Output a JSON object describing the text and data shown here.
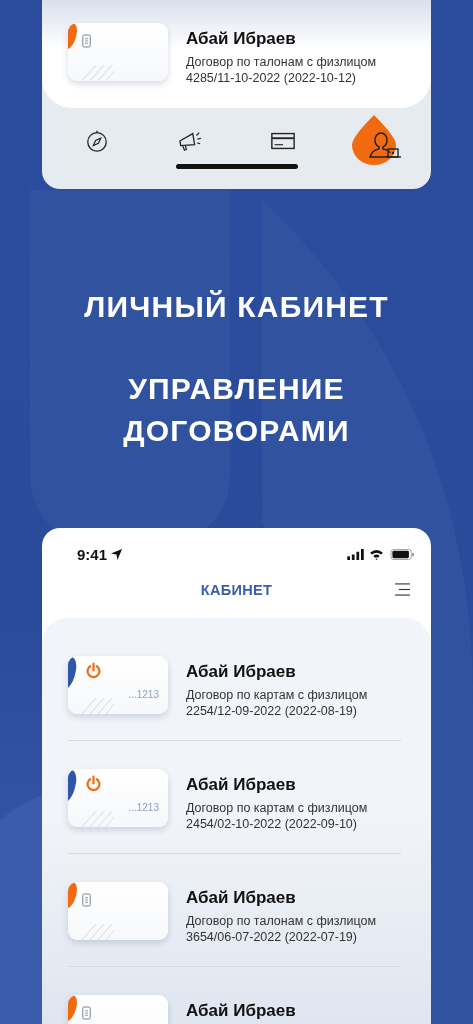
{
  "top_screen": {
    "contracts": [
      {
        "kind": "tickets",
        "name": "Абай Ибраев",
        "type": "Договор по талонам с физлицом",
        "number": "4285/11-10-2022 (2022-10-12)"
      }
    ],
    "tabs": [
      {
        "kind": "compass",
        "selected": false
      },
      {
        "kind": "megaphone",
        "selected": false
      },
      {
        "kind": "card",
        "selected": false
      },
      {
        "kind": "profile",
        "selected": true
      }
    ]
  },
  "headline": [
    "ЛИЧНЫЙ КАБИНЕТ",
    "УПРАВЛЕНИЕ ДОГОВОРАМИ"
  ],
  "bottom_screen": {
    "status_bar": {
      "time": "9:41"
    },
    "title": "КАБИНЕТ",
    "contracts": [
      {
        "kind": "cards",
        "card_suffix": "...1213",
        "name": "Абай Ибраев",
        "type": "Договор по картам с физлицом",
        "number": "2254/12-09-2022 (2022-08-19)"
      },
      {
        "kind": "cards",
        "card_suffix": "...1213",
        "name": "Абай Ибраев",
        "type": "Договор по картам с физлицом",
        "number": "2454/02-10-2022 (2022-09-10)"
      },
      {
        "kind": "tickets",
        "name": "Абай Ибраев",
        "type": "Договор по талонам с физлицом",
        "number": "3654/06-07-2022 (2022-07-19)"
      },
      {
        "kind": "tickets",
        "name": "Абай Ибраев"
      }
    ]
  }
}
